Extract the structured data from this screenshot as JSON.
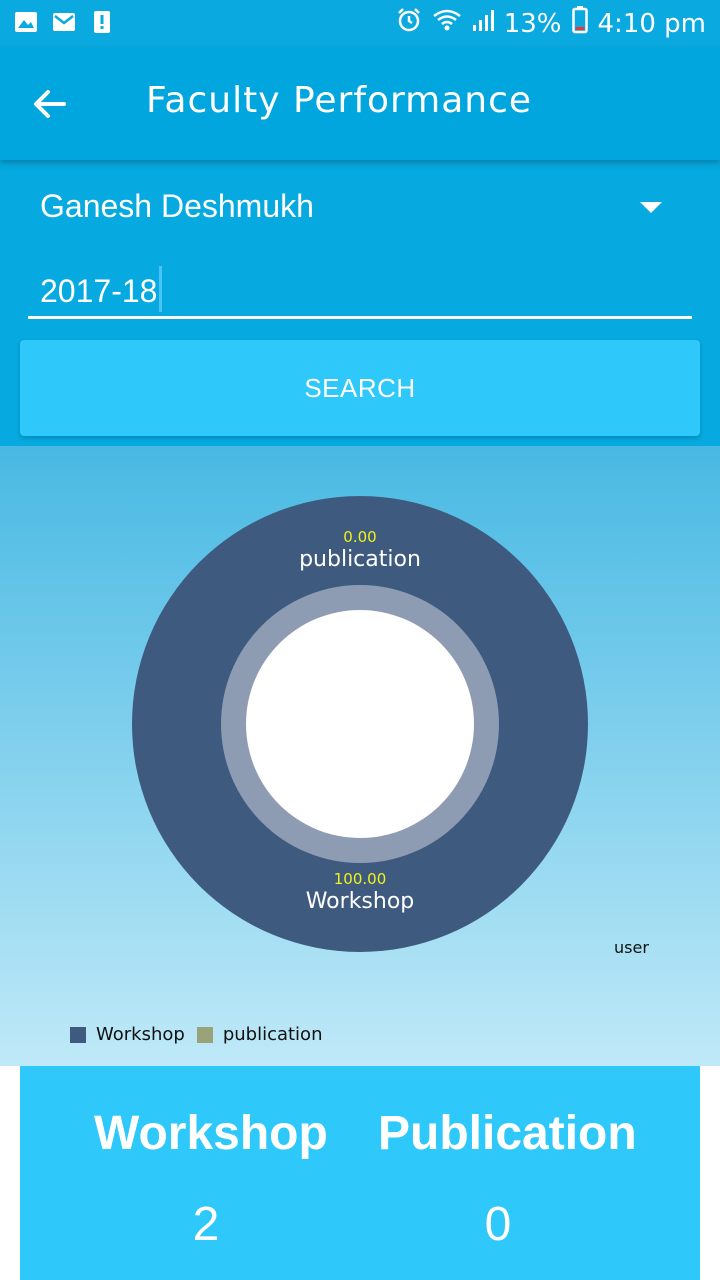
{
  "status_bar": {
    "battery": "13%",
    "time": "4:10 pm",
    "left_icons": [
      "image-icon",
      "gmail-icon",
      "alert-icon"
    ],
    "right_icons": [
      "alarm-icon",
      "wifi-icon",
      "signal-icon",
      "battery-icon"
    ]
  },
  "app_bar": {
    "title": "Faculty Performance"
  },
  "form": {
    "faculty_name": "Ganesh Deshmukh",
    "year_value": "2017-18",
    "search_label": "SEARCH"
  },
  "chart_data": {
    "type": "pie",
    "categories": [
      "Workshop",
      "publication"
    ],
    "values": [
      100.0,
      0.0
    ],
    "value_labels": [
      "100.00",
      "0.00"
    ],
    "center_label": "user",
    "legend": [
      "Workshop",
      "publication"
    ],
    "legend_position": "bottom-left",
    "colors": {
      "Workshop": "#3f5a7f",
      "publication": "#9aa27a"
    }
  },
  "stats": {
    "workshop_label": "Workshop",
    "workshop_count": "2",
    "publication_label": "Publication",
    "publication_count": "0"
  },
  "colors": {
    "primary": "#02a6de",
    "accent": "#2ec8fb",
    "value_text": "#f2f21a"
  }
}
